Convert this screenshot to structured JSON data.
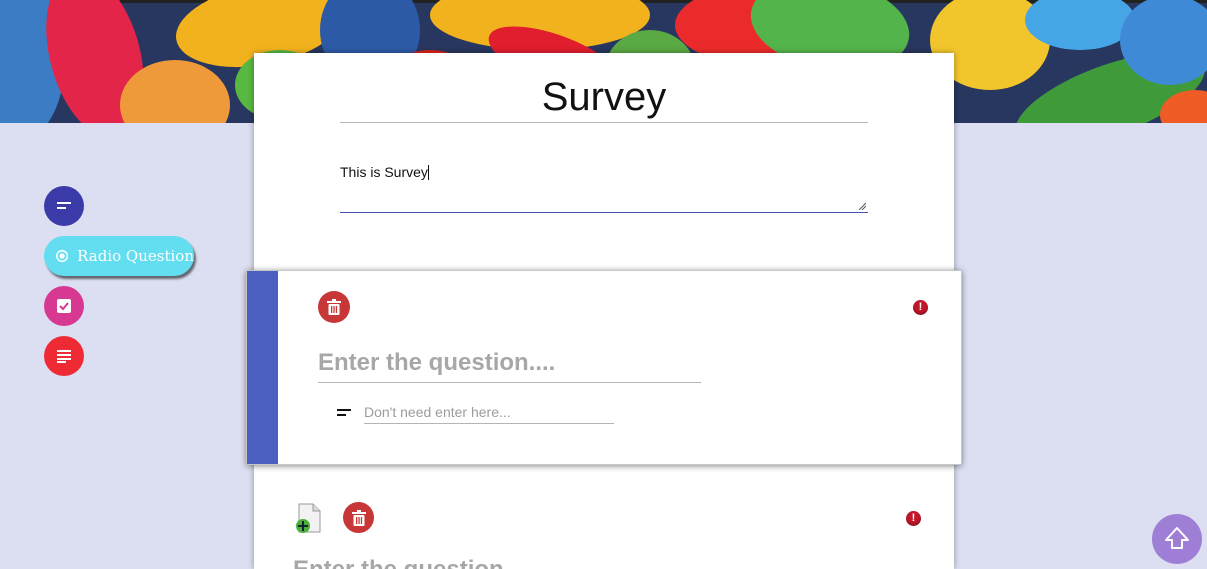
{
  "survey": {
    "title": "Survey",
    "description": "This is Survey"
  },
  "tools": {
    "text_question_icon": "short-text-icon",
    "radio_question_label": "Radio Question",
    "radio_question_icon": "radio-button-icon",
    "checkbox_question_icon": "checkbox-icon",
    "paragraph_question_icon": "paragraph-icon",
    "colors": {
      "text": "#3a3aa8",
      "radio": "#62def0",
      "checkbox": "#d63892",
      "paragraph": "#ee2b35"
    }
  },
  "question_1": {
    "placeholder": "Enter the question....",
    "answer_placeholder": "Don't need enter here...",
    "answer_type_icon": "short-text-icon",
    "delete_icon": "trash-icon",
    "status_icon": "alert-icon",
    "accent_color": "#4a5fbf"
  },
  "question_2": {
    "placeholder": "Enter the question....",
    "add_icon": "add-file-icon",
    "delete_icon": "trash-icon",
    "status_icon": "alert-icon"
  },
  "alert_symbol": "!",
  "scroll_top_icon": "arrow-up-icon"
}
